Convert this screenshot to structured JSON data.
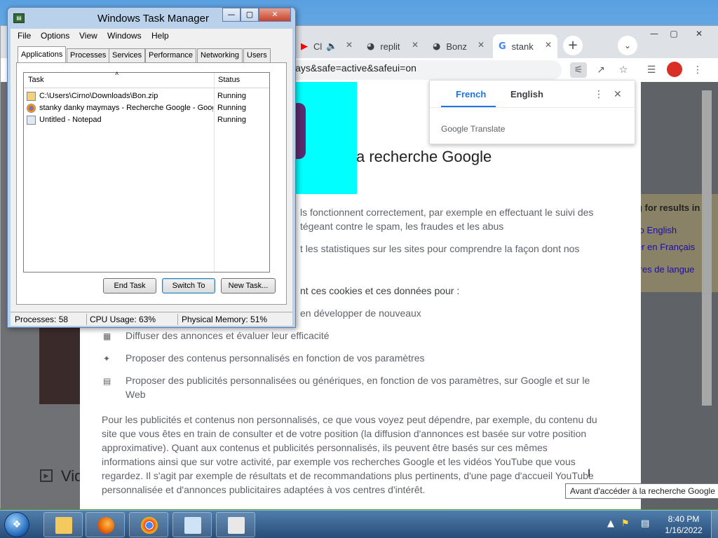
{
  "chrome": {
    "tabs": [
      {
        "label": "Cl",
        "icon": "youtube-icon",
        "audio": "speaker-icon"
      },
      {
        "label": "replit",
        "icon": "globe-icon"
      },
      {
        "label": "Bonz",
        "icon": "globe-icon"
      },
      {
        "label": "stank",
        "icon": "google-icon"
      }
    ],
    "url": "maymays&safe=active&safeui=on",
    "translate_popup": {
      "tabs": [
        "French",
        "English"
      ],
      "brand": "Google Translate"
    }
  },
  "consent": {
    "title_partial": "a recherche Google",
    "lines": [
      {
        "text": "ls fonctionnent correctement, par exemple en effectuant le suivi des"
      },
      {
        "text": "tégeant contre le spam, les fraudes et les abus"
      },
      {
        "text": "t les statistiques sur les sites pour comprendre la façon dont nos"
      },
      {
        "text": "nt ces cookies et ces données pour :"
      },
      {
        "text": "en développer de nouveaux"
      },
      {
        "text": "Diffuser des annonces et évaluer leur efficacité"
      },
      {
        "text": "Proposer des contenus personnalisés en fonction de vos paramètres"
      },
      {
        "text": "Proposer des publicités personnalisées ou génériques, en fonction de vos paramètres, sur Google et sur le"
      },
      {
        "text": "Web"
      }
    ],
    "paragraph": [
      "Pour les publicités et contenus non personnalisés, ce que vous voyez peut dépendre, par exemple, du contenu du",
      "site que vous êtes en train de consulter et de votre position (la diffusion d'annonces est basée sur votre position",
      "approximative). Quant aux contenus et publicités personnalisés, ils peuvent être basés sur ces mêmes",
      "informations ainsi que sur votre activité, par exemple vos recherches Google et les vidéos YouTube que vous",
      "regardez. Il s'agit par exemple de résultats et de recommandations plus pertinents, d'une page d'accueil YouTube",
      "personnalisée et d'annonces publicitaires adaptées à vos centres d'intérêt."
    ],
    "right_panel": [
      "g for results in",
      "to English",
      "er en Français",
      "tres de langue"
    ],
    "left_partial": "Vid",
    "tooltip": "Avant d'accéder à la recherche Google"
  },
  "taskmanager": {
    "title": "Windows Task Manager",
    "menu": [
      "File",
      "Options",
      "View",
      "Windows",
      "Help"
    ],
    "tabs": [
      "Applications",
      "Processes",
      "Services",
      "Performance",
      "Networking",
      "Users"
    ],
    "columns": {
      "task": "Task",
      "status": "Status"
    },
    "rows": [
      {
        "task": "C:\\Users\\Cirno\\Downloads\\Bon.zip",
        "status": "Running"
      },
      {
        "task": "stanky danky maymays - Recherche Google - Google Chrome",
        "status": "Running"
      },
      {
        "task": "Untitled - Notepad",
        "status": "Running"
      }
    ],
    "buttons": {
      "end_task": "End Task",
      "switch_to": "Switch To",
      "new_task": "New Task..."
    },
    "status": {
      "processes": "Processes: 58",
      "cpu": "CPU Usage: 63%",
      "memory": "Physical Memory: 51%"
    }
  },
  "taskbar": {
    "time": "8:40 PM",
    "date": "1/16/2022",
    "pinned": [
      "explorer",
      "firefox",
      "chrome",
      "notepad",
      "task-manager"
    ]
  },
  "colors": {
    "accent": "#1a73e8",
    "cyan": "#00ffff"
  }
}
